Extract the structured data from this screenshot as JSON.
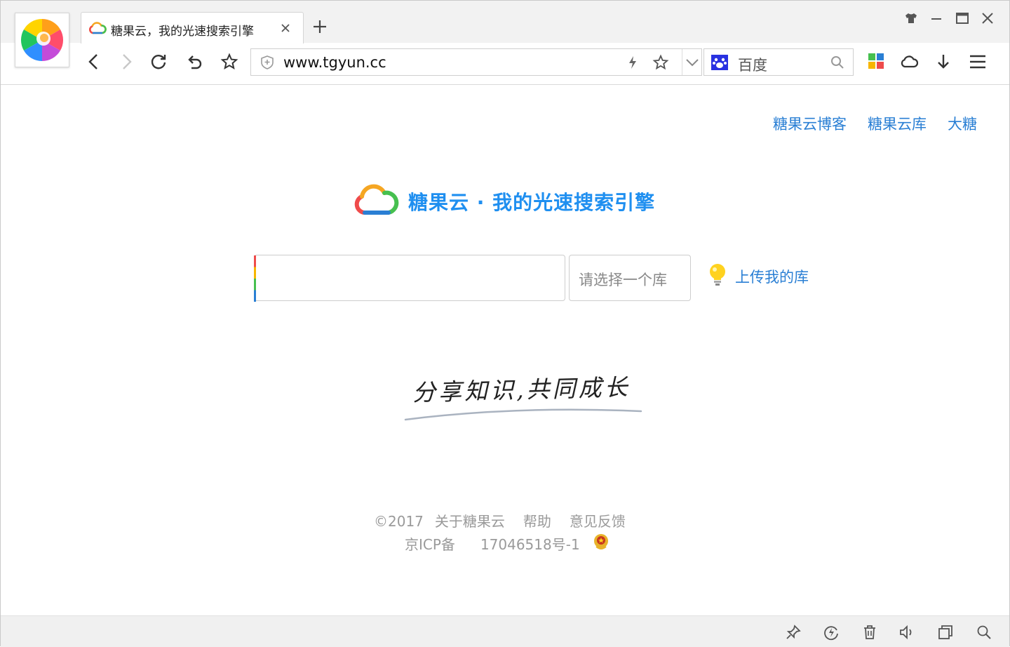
{
  "browser": {
    "tab": {
      "title": "糖果云，我的光速搜索引擎"
    },
    "address": {
      "url": "www.tgyun.cc"
    },
    "search": {
      "engine": "百度"
    },
    "icons": {
      "logo": "browser-logo-icon",
      "skin": "shirt-icon",
      "minimize": "minimize-icon",
      "maximize": "maximize-icon",
      "close": "close-icon",
      "back": "back-icon",
      "forward": "forward-icon",
      "reload": "reload-icon",
      "undo": "undo-icon",
      "favorite": "star-icon",
      "security": "shield-icon",
      "speed": "lightning-icon",
      "apps": "apps-grid-icon",
      "cloud": "cloud-icon",
      "download": "download-icon",
      "menu": "menu-icon"
    }
  },
  "page": {
    "top_links": [
      "糖果云博客",
      "糖果云库",
      "大糖"
    ],
    "brand": "糖果云 · 我的光速搜索引擎",
    "search": {
      "value": "",
      "library_placeholder": "请选择一个库"
    },
    "upload_link": "上传我的库",
    "slogan": "分享知识,共同成长",
    "footer": {
      "year": "©2017",
      "about": "关于糖果云",
      "help": "帮助",
      "feedback": "意见反馈",
      "icp_label": "京ICP备",
      "icp_number": "17046518号-1"
    }
  },
  "statusbar": {
    "icons": [
      "pin-icon",
      "speedup-icon",
      "trash-icon",
      "sound-icon",
      "window-icon",
      "zoom-icon"
    ]
  },
  "colors": {
    "link": "#2a7fd4",
    "brand": "#1f8ff0",
    "footer": "#9a9a9a"
  }
}
